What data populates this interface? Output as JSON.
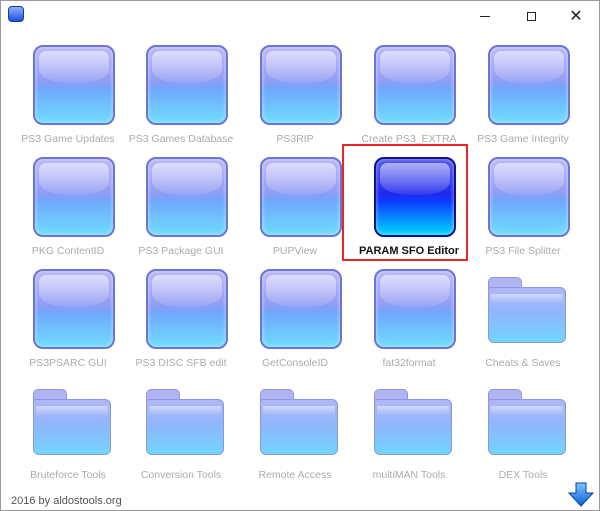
{
  "window": {
    "icon": "app-blue-orb-icon",
    "controls": {
      "minimize": "minimize-icon",
      "maximize": "maximize-icon",
      "close": "close-icon",
      "close_glyph": "✕"
    }
  },
  "tiles": [
    {
      "label": "PS3 Game Updates",
      "kind": "button"
    },
    {
      "label": "PS3 Games Database",
      "kind": "button"
    },
    {
      "label": "PS3RIP",
      "kind": "button"
    },
    {
      "label": "Create PS3_EXTRA",
      "kind": "button"
    },
    {
      "label": "PS3 Game Integrity",
      "kind": "button"
    },
    {
      "label": "PKG ContentID",
      "kind": "button"
    },
    {
      "label": "PS3 Package GUI",
      "kind": "button"
    },
    {
      "label": "PUPView",
      "kind": "button"
    },
    {
      "label": "PARAM SFO Editor",
      "kind": "button",
      "selected": true
    },
    {
      "label": "PS3 File Splitter",
      "kind": "button"
    },
    {
      "label": "PS3PSARC GUI",
      "kind": "button"
    },
    {
      "label": "PS3 DISC SFB edit",
      "kind": "button"
    },
    {
      "label": "GetConsoleID",
      "kind": "button"
    },
    {
      "label": "fat32format",
      "kind": "button"
    },
    {
      "label": "Cheats & Saves",
      "kind": "folder"
    },
    {
      "label": "Bruteforce Tools",
      "kind": "folder"
    },
    {
      "label": "Conversion Tools",
      "kind": "folder"
    },
    {
      "label": "Remote Access",
      "kind": "folder"
    },
    {
      "label": "multiMAN Tools",
      "kind": "folder"
    },
    {
      "label": "DEX Tools",
      "kind": "folder"
    }
  ],
  "colors": {
    "selection": "#e8262a",
    "label": "#ababab",
    "active_label": "#111111"
  },
  "footer": {
    "text": "2016 by aldostools.org"
  },
  "download_icon": "download-arrow-icon"
}
